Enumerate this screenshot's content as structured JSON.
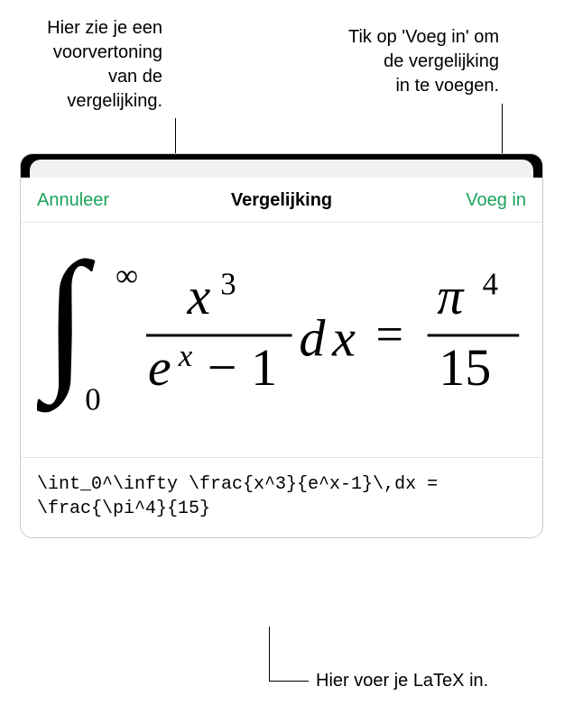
{
  "callouts": {
    "preview": "Hier zie je een\nvoorvertoning\nvan de\nvergelijking.",
    "insert": "Tik op 'Voeg in' om\nde vergelijking\nin te voegen.",
    "input": "Hier voer je LaTeX in."
  },
  "header": {
    "cancel": "Annuleer",
    "title": "Vergelijking",
    "insert": "Voeg in"
  },
  "equation": {
    "latex": "\\int_0^\\infty \\frac{x^3}{e^x-1}\\,dx = \\frac{\\pi^4}{15}"
  },
  "colors": {
    "accent": "#1aa35b"
  }
}
